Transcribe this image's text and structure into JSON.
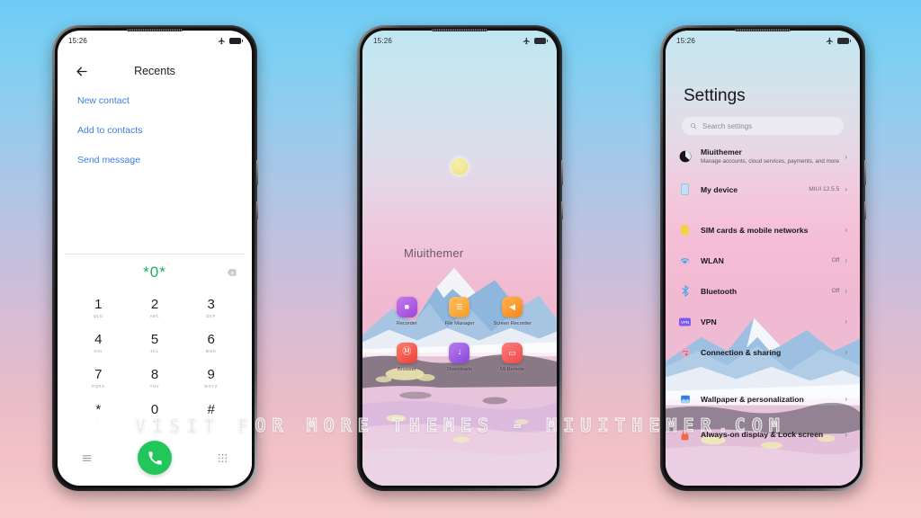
{
  "watermark": {
    "text": "VISIT FOR MORE THEMES - MIUITHEMER.COM"
  },
  "theme": {
    "accent_green": "#22c65b",
    "link_blue": "#3b7fe0",
    "bg_top": "#6ecbf5",
    "bg_bottom": "#f7cbcb"
  },
  "phone1": {
    "status": {
      "time": "15:26",
      "airplane_icon": "airplane-icon",
      "battery_icon": "battery-icon"
    },
    "header": {
      "back_icon": "back-arrow-icon",
      "title": "Recents"
    },
    "links": [
      {
        "label": "New contact"
      },
      {
        "label": "Add to contacts"
      },
      {
        "label": "Send message"
      }
    ],
    "dialer": {
      "entry": "*0*",
      "backspace_icon": "backspace-icon",
      "keys": [
        {
          "num": "1",
          "sub": "QLD"
        },
        {
          "num": "2",
          "sub": "ABC"
        },
        {
          "num": "3",
          "sub": "DEF"
        },
        {
          "num": "4",
          "sub": "GHI"
        },
        {
          "num": "5",
          "sub": "JKL"
        },
        {
          "num": "6",
          "sub": "MNO"
        },
        {
          "num": "7",
          "sub": "PQRS"
        },
        {
          "num": "8",
          "sub": "TUV"
        },
        {
          "num": "9",
          "sub": "WXYZ"
        },
        {
          "num": "*",
          "sub": ","
        },
        {
          "num": "0",
          "sub": "+"
        },
        {
          "num": "#",
          "sub": ""
        }
      ],
      "menu_icon": "menu-icon",
      "call_icon": "phone-call-icon",
      "keypad_icon": "keypad-icon"
    }
  },
  "phone2": {
    "status": {
      "time": "15:26",
      "airplane_icon": "airplane-icon",
      "battery_icon": "battery-icon"
    },
    "wallpaper_text": "Miuithemer",
    "moon_icon": "moon-icon",
    "apps": [
      {
        "label": "Recorder",
        "icon": "recorder-icon",
        "color": "#b05ce0",
        "glyph": "■"
      },
      {
        "label": "File\nManager",
        "icon": "file-manager-icon",
        "color": "#f5a93c",
        "glyph": "☰"
      },
      {
        "label": "Screen\nRecorder",
        "icon": "screen-recorder-icon",
        "color": "#f59324",
        "glyph": "◀"
      },
      {
        "label": "Browser",
        "icon": "browser-icon",
        "color": "#ef5b4c",
        "glyph": "Ⓘ"
      },
      {
        "label": "Downloads",
        "icon": "downloads-icon",
        "color": "#9b5ce6",
        "glyph": "↓"
      },
      {
        "label": "Mi Remote",
        "icon": "mi-remote-icon",
        "color": "#ef5b5b",
        "glyph": "▫"
      }
    ]
  },
  "phone3": {
    "status": {
      "time": "15:26",
      "airplane_icon": "airplane-icon",
      "battery_icon": "battery-icon"
    },
    "title": "Settings",
    "search": {
      "icon": "search-icon",
      "placeholder": "Search settings"
    },
    "account": {
      "icon": "account-avatar-icon",
      "name": "Miuithemer",
      "sub": "Manage accounts, cloud services, payments, and more",
      "chevron": "›"
    },
    "items": [
      {
        "name": "My device",
        "icon": "device-icon",
        "value": "MIUI 12.5.5",
        "chevron": "›"
      },
      {
        "name": "SIM cards & mobile networks",
        "icon": "sim-card-icon",
        "value": "",
        "chevron": "›"
      },
      {
        "name": "WLAN",
        "icon": "wifi-icon",
        "value": "Off",
        "chevron": "›"
      },
      {
        "name": "Bluetooth",
        "icon": "bluetooth-icon",
        "value": "Off",
        "chevron": "›"
      },
      {
        "name": "VPN",
        "icon": "vpn-icon",
        "value": "",
        "chevron": "›"
      },
      {
        "name": "Connection & sharing",
        "icon": "connection-icon",
        "value": "",
        "chevron": "›"
      },
      {
        "name": "Wallpaper & personalization",
        "icon": "wallpaper-icon",
        "value": "",
        "chevron": "›"
      },
      {
        "name": "Always-on display & Lock screen",
        "icon": "lockscreen-icon",
        "value": "",
        "chevron": "›"
      }
    ]
  }
}
